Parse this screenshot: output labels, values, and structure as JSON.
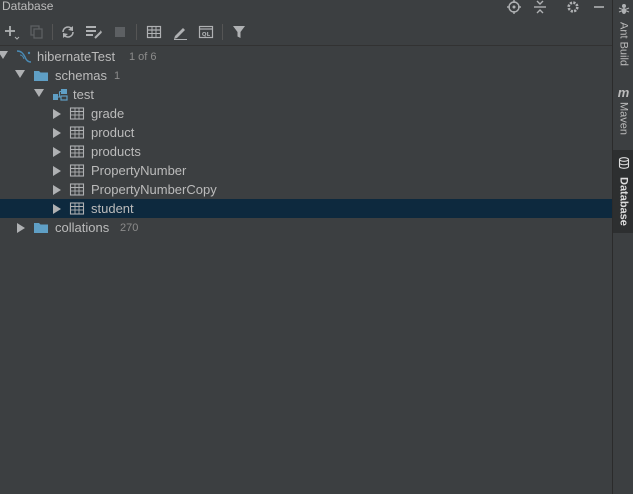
{
  "panel": {
    "title": "Database"
  },
  "title_icons": [
    "locate-icon",
    "collapse-all-icon",
    "gear-icon",
    "minimize-icon"
  ],
  "toolbar": {
    "tools": [
      "add-icon",
      "copy-icon",
      "refresh-icon",
      "schema-sync-icon",
      "stop-icon",
      "table-icon",
      "edit-icon",
      "sql-console-icon",
      "filter-icon"
    ]
  },
  "tree": {
    "root": {
      "label": "hibernateTest",
      "count": "1 of 6"
    },
    "schemas": {
      "label": "schemas",
      "count": "1"
    },
    "schema": {
      "label": "test"
    },
    "tables": [
      "grade",
      "product",
      "products",
      "PropertyNumber",
      "PropertyNumberCopy",
      "student"
    ],
    "collations": {
      "label": "collations",
      "count": "270"
    }
  },
  "stripe": {
    "ant": "Ant Build",
    "maven_glyph": "m",
    "maven": "Maven",
    "database": "Database"
  },
  "colors": {
    "background": "#3c3f41",
    "selection": "#0d293e",
    "folder": "#5f9fc5",
    "text": "#bbbbbb"
  }
}
